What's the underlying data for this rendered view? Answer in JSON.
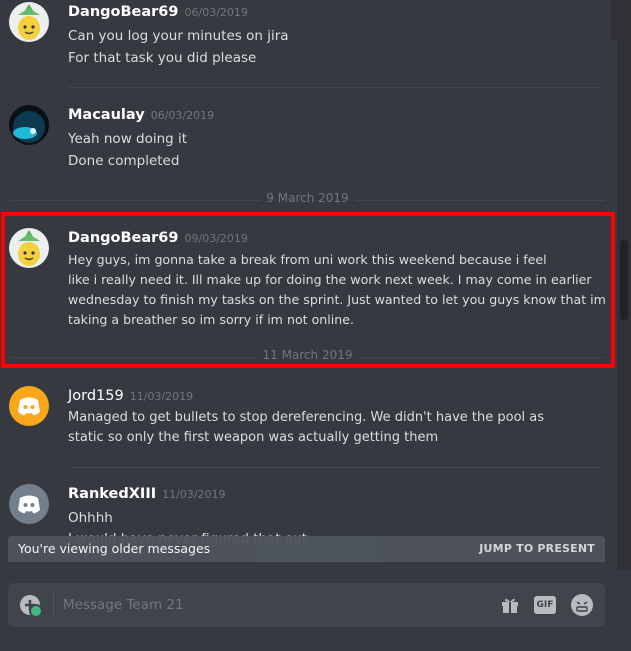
{
  "messages": [
    {
      "username": "DangoBear69",
      "timestamp": "06/03/2019",
      "lines": [
        "Can you log your minutes on jira",
        "For that task you did please"
      ],
      "avatar_icon": "pineapple-icon"
    },
    {
      "username": "Macaulay",
      "timestamp": "06/03/2019",
      "lines": [
        "Yeah now doing it",
        "Done completed"
      ],
      "avatar_icon": "landscape-icon"
    },
    {
      "username": "DangoBear69",
      "timestamp": "09/03/2019",
      "lines": [
        "Hey guys, im gonna take a break from uni work this weekend because i feel",
        "like i really need it. Ill make up for doing the work next week. I may come in earlier",
        "wednesday to finish my tasks on the sprint. Just wanted to let you guys know that im",
        "taking a breather so im sorry if im not online."
      ],
      "avatar_icon": "pineapple-icon"
    },
    {
      "username": "Jord159",
      "timestamp": "11/03/2019",
      "lines": [
        "Managed to get bullets to stop dereferencing. We didn't have the pool as",
        "static so only the first weapon was actually getting them"
      ],
      "avatar_icon": "discord-icon",
      "avatar_color": "#faa61a"
    },
    {
      "username": "RankedXIII",
      "timestamp": "11/03/2019",
      "lines": [
        "Ohhhh",
        "I would have never figured that out"
      ],
      "avatar_icon": "discord-icon",
      "avatar_color": "#747f8d"
    }
  ],
  "dividers": {
    "d1": "9 March 2019",
    "d2": "11 March 2019"
  },
  "older_bar": {
    "text": "You're viewing older messages",
    "jump": "JUMP TO PRESENT"
  },
  "composer": {
    "placeholder": "Message Team 21",
    "gif_label": "GIF"
  },
  "colors": {
    "background": "#36393f",
    "highlight": "#ff0000",
    "text": "#dcddde",
    "muted": "#72767d"
  }
}
